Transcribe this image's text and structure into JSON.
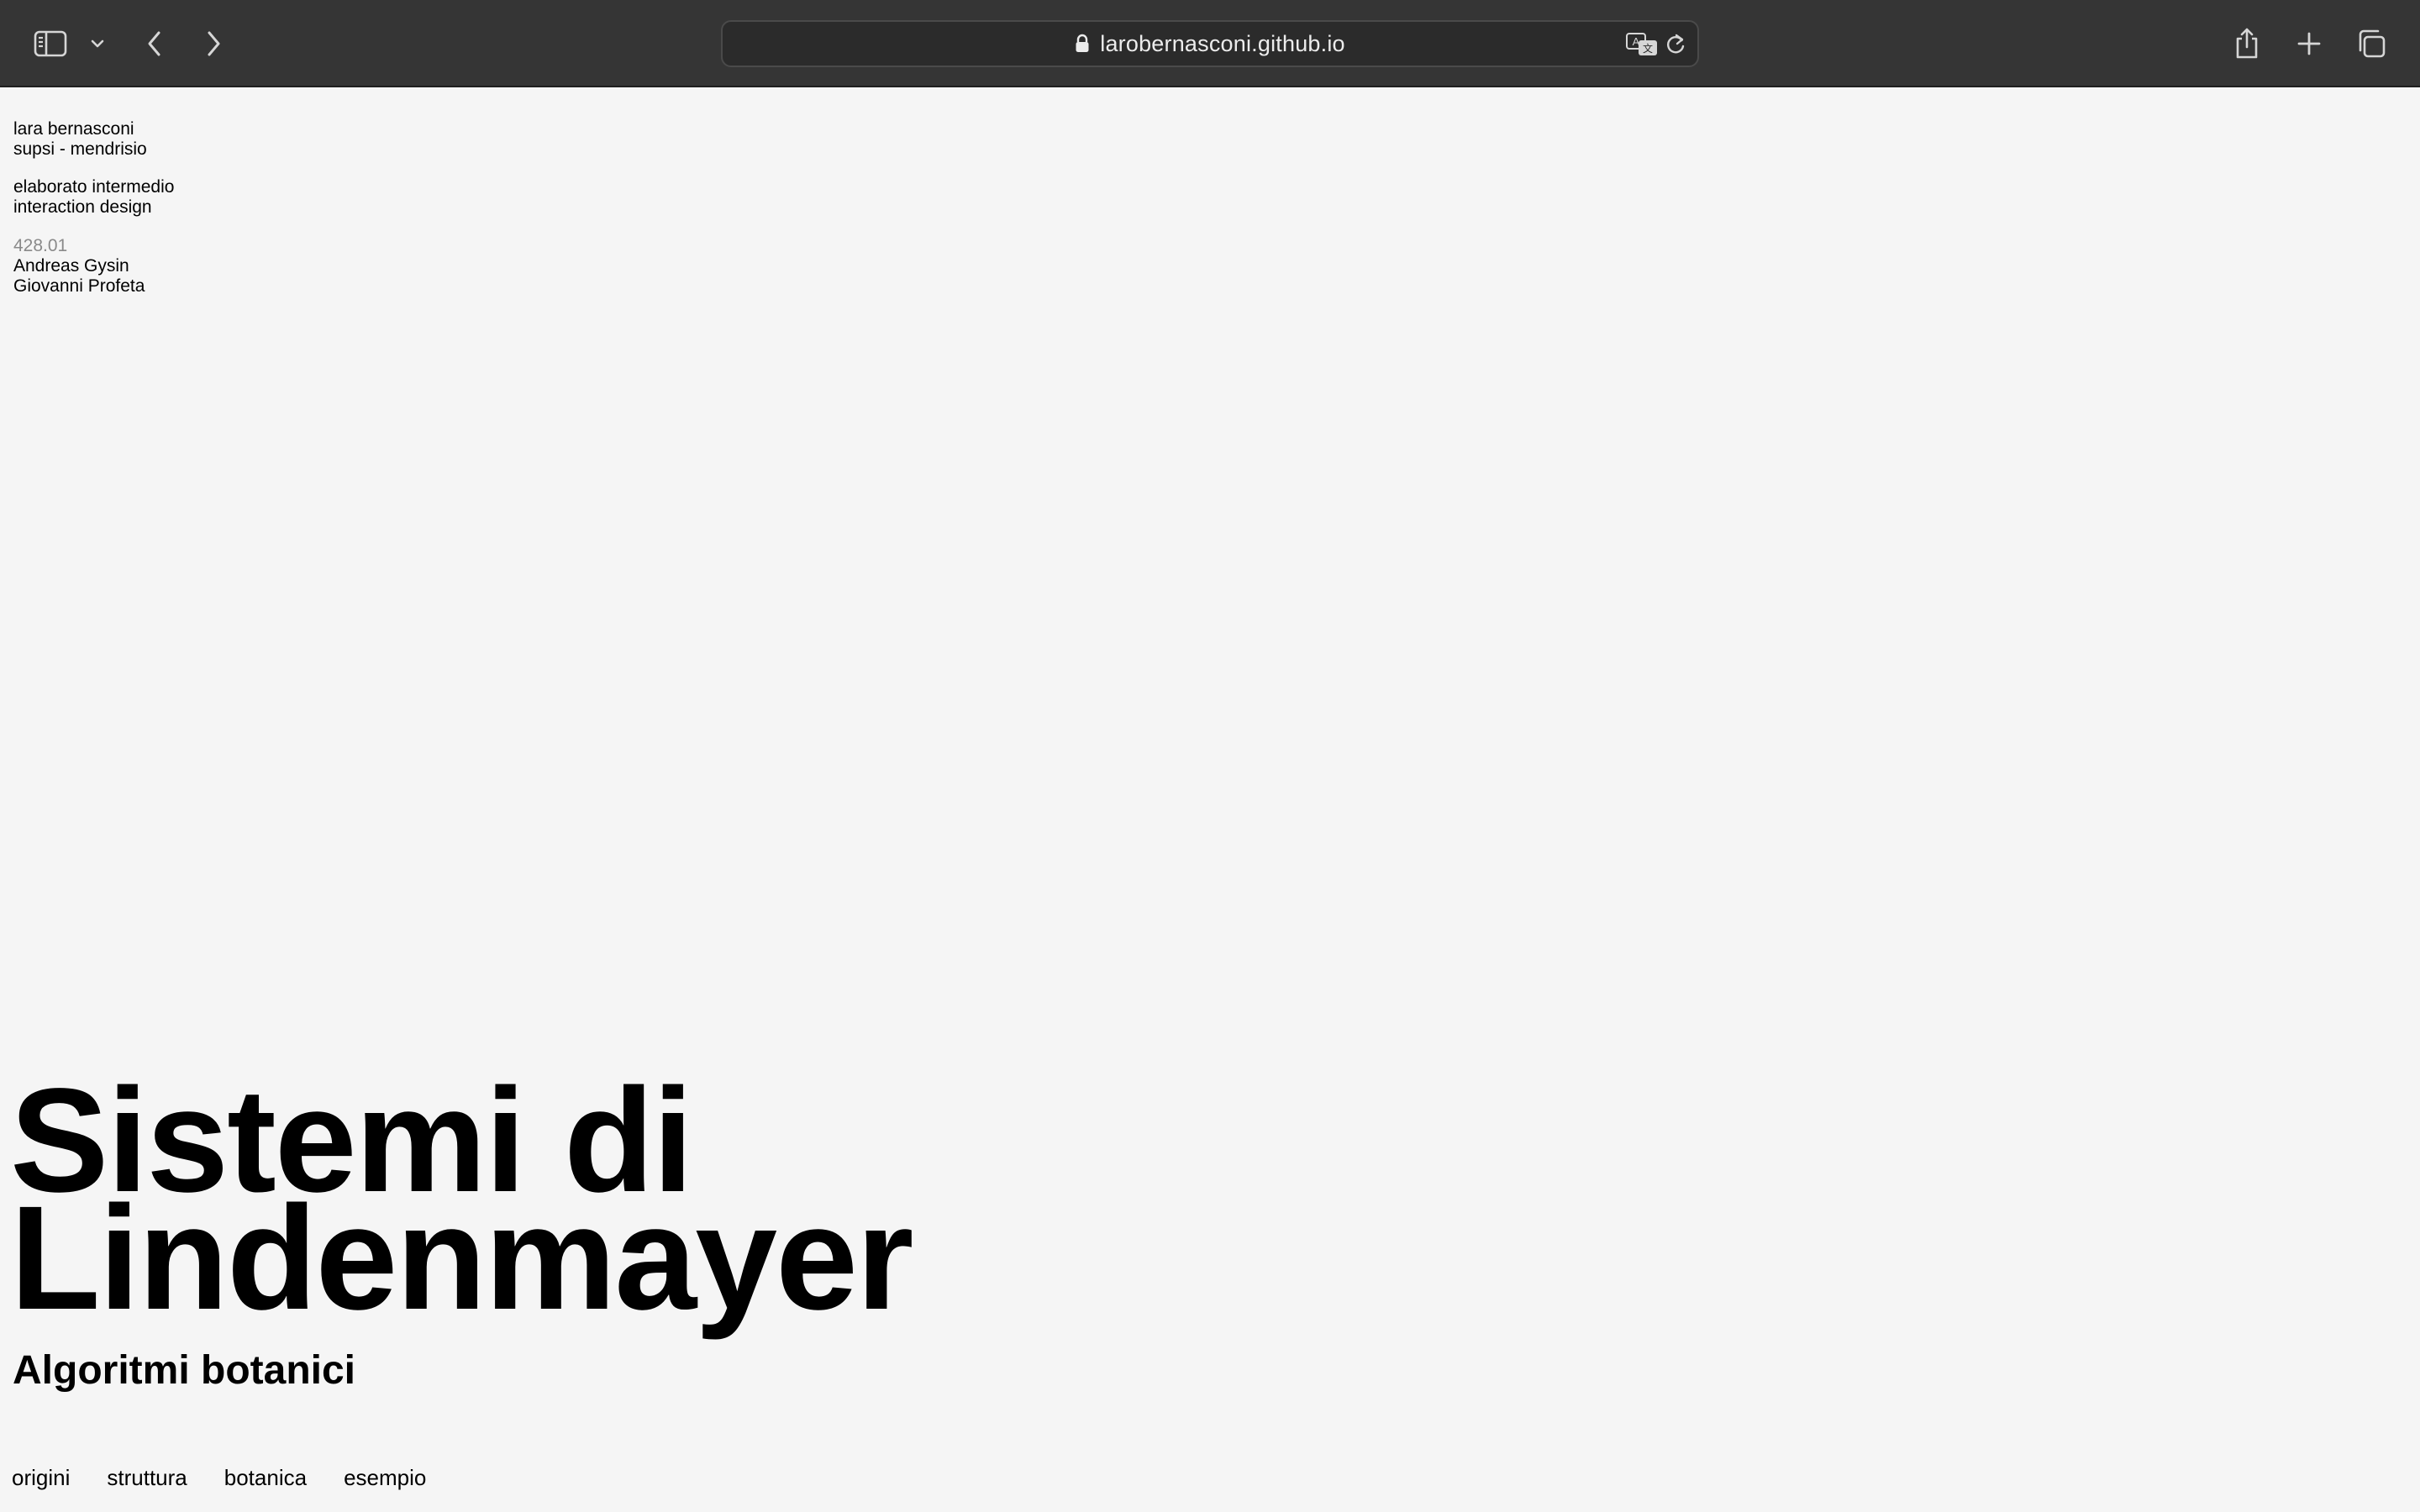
{
  "browser": {
    "url": "larobernasconi.github.io",
    "icons": {
      "sidebar": "sidebar-icon",
      "dropdown": "chevron-down-icon",
      "back": "chevron-left-icon",
      "forward": "chevron-right-icon",
      "lock": "lock-icon",
      "translate": "translate-icon",
      "reload": "reload-icon",
      "share": "share-icon",
      "new_tab": "plus-icon",
      "tabs": "tabs-overview-icon"
    },
    "colors": {
      "toolbar_bg": "#353535",
      "address_bg": "#2b2b2b",
      "icon": "#d6d6d6"
    }
  },
  "page": {
    "author": {
      "name": "lara bernasconi",
      "school": "supsi - mendrisio"
    },
    "course": {
      "type": "elaborato intermedio",
      "field": "interaction design"
    },
    "class": {
      "code": "428.01",
      "teacher_1": "Andreas Gysin",
      "teacher_2": "Giovanni Profeta"
    },
    "title_line_1": "Sistemi di",
    "title_line_2": "Lindenmayer",
    "subtitle": "Algoritmi botanici",
    "nav": [
      {
        "label": "origini"
      },
      {
        "label": "struttura"
      },
      {
        "label": "botanica"
      },
      {
        "label": "esempio"
      }
    ],
    "colors": {
      "background": "#f5f5f5",
      "text": "#000000",
      "muted": "#8a8a8a"
    }
  }
}
